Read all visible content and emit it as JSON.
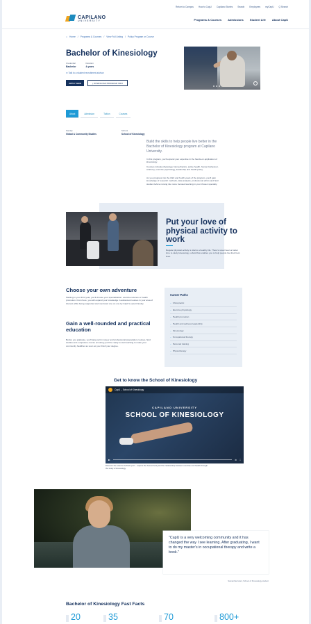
{
  "utility_nav": [
    "Return to Campus",
    "How to CapU",
    "Capilano Stories",
    "Search",
    "Employees",
    "myCapU",
    "Q Search"
  ],
  "logo": {
    "line1": "CAPILANO",
    "line2": "UNIVERSITY"
  },
  "main_nav": [
    "Programs & Courses",
    "Admissions",
    "Student Life",
    "About CapU"
  ],
  "breadcrumb": [
    "Home",
    "Programs & Courses",
    "View Full Listing",
    "Policy Program or Course"
  ],
  "program": {
    "title": "Bachelor of Kinesiology",
    "credential_label": "Credential",
    "credential_value": "Bachelor",
    "duration_label": "Duration",
    "duration_value": "4 years",
    "eligibility_link": "Talk to a student recruitment advisor",
    "apply_label": "APPLY NOW",
    "download_label": "DOWNLOAD PROGRAM INFO"
  },
  "tabs": [
    "About",
    "Admission",
    "Tuition",
    "Courses"
  ],
  "about": {
    "faculty_label": "Faculty",
    "faculty_value": "Global & Community Studies",
    "school_label": "School",
    "school_value": "School of Kinesiology",
    "lead": "Build the skills to help people live better in the Bachelor of Kinesiology program at Capilano University.",
    "p1": "In this program, you'll expand your expertise in the hands-on application of kinesiology.",
    "p2": "Courses include physiology, biomechanics, active health, human behaviour, anatomy, exercise psychology, leadership and health policy.",
    "p3": "As you progress into the third and fourth years of the program, you'll gain knowledge of research methods, data analysis, professional ethics and field studies before moving into more focused learning in your chosen specialty."
  },
  "feature": {
    "title": "Put your love of physical activity to work",
    "text": "Regular physical activity is vital to a healthy life. There's never been a better time to study kinesiology, a field that enables you to help people live their best lives."
  },
  "adventure": {
    "title": "Choose your own adventure",
    "text": "Starting in your third year, you'll choose your specialization: exercise science or health promotion. From here, you will expand your knowledge in advanced courses in your area of interest while being supported and mentored one on one by CapU's expert faculty."
  },
  "gain": {
    "title": "Gain a well-rounded and practical education",
    "text": "Before you graduate, you'll take part in career and professional preparation courses, field studies and a capstone course ensuring you'll be ready to start working to make your community healthier as soon as you finish your degree."
  },
  "career": {
    "title": "Career Paths",
    "items": [
      "Chiropractic",
      "Exercise physiology",
      "Health promotion",
      "Health and wellness leadership",
      "Kinesiology",
      "Occupational therapy",
      "Personal training",
      "Physiotherapy"
    ]
  },
  "video": {
    "section_title": "Get to know the School of Kinesiology",
    "player_title": "CapU – School of Kinesiology",
    "overlay_small": "CAPILANO UNIVERSITY",
    "overlay_big": "SCHOOL OF KINESIOLOGY",
    "caption": "Discover the science behind sport – explore the human body and the relationship between exercise and health through the study of kinesiology."
  },
  "testimonial": {
    "quote": "\"CapU is a very welcoming community and it has changed the way I see learning. After graduating, I want to do my master's in occupational therapy and write a book.\"",
    "attribution": "Samantha Grant, School of Kinesiology student"
  },
  "facts": {
    "title": "Bachelor of Kinesiology Fast Facts",
    "values": [
      "20",
      "35",
      "70",
      "800+"
    ]
  },
  "colors": {
    "navy": "#14305c",
    "accent": "#1e9ad6",
    "gold": "#f1a41c"
  }
}
